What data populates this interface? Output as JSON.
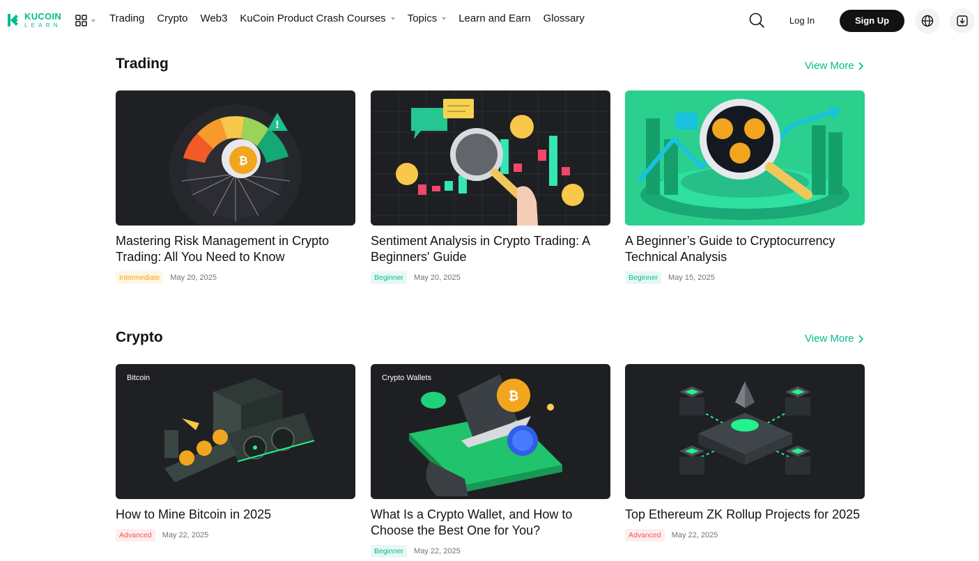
{
  "brand": {
    "name_top": "KUCOIN",
    "name_bottom": "LEARN",
    "accent_color": "#01bc8d"
  },
  "header": {
    "apps_icon": "grid-apps-icon",
    "nav": [
      {
        "label": "Trading",
        "has_dropdown": false
      },
      {
        "label": "Crypto",
        "has_dropdown": false
      },
      {
        "label": "Web3",
        "has_dropdown": false
      },
      {
        "label": "KuCoin Product Crash Courses",
        "has_dropdown": true
      },
      {
        "label": "Topics",
        "has_dropdown": true
      },
      {
        "label": "Learn and Earn",
        "has_dropdown": false
      },
      {
        "label": "Glossary",
        "has_dropdown": false
      }
    ],
    "search_icon": "search-icon",
    "login_label": "Log In",
    "signup_label": "Sign Up",
    "language_icon": "globe-icon",
    "download_icon": "download-icon"
  },
  "sections": [
    {
      "title": "Trading",
      "view_more": "View More",
      "cards": [
        {
          "title": "Mastering Risk Management in Crypto Trading: All You Need to Know",
          "level": "Intermediate",
          "date": "May 20, 2025",
          "tag": ""
        },
        {
          "title": "Sentiment Analysis in Crypto Trading: A Beginners' Guide",
          "level": "Beginner",
          "date": "May 20, 2025",
          "tag": ""
        },
        {
          "title": "A Beginner’s Guide to Cryptocurrency Technical Analysis",
          "level": "Beginner",
          "date": "May 15, 2025",
          "tag": ""
        }
      ]
    },
    {
      "title": "Crypto",
      "view_more": "View More",
      "cards": [
        {
          "title": "How to Mine Bitcoin in 2025",
          "level": "Advanced",
          "date": "May 22, 2025",
          "tag": "Bitcoin"
        },
        {
          "title": "What Is a Crypto Wallet, and How to Choose the Best One for You?",
          "level": "Beginner",
          "date": "May 22, 2025",
          "tag": "Crypto Wallets"
        },
        {
          "title": "Top Ethereum ZK Rollup Projects for 2025",
          "level": "Advanced",
          "date": "May 22, 2025",
          "tag": ""
        }
      ]
    }
  ],
  "level_colors": {
    "Intermediate": "#f7a600",
    "Beginner": "#01bc8d",
    "Advanced": "#f65454"
  }
}
